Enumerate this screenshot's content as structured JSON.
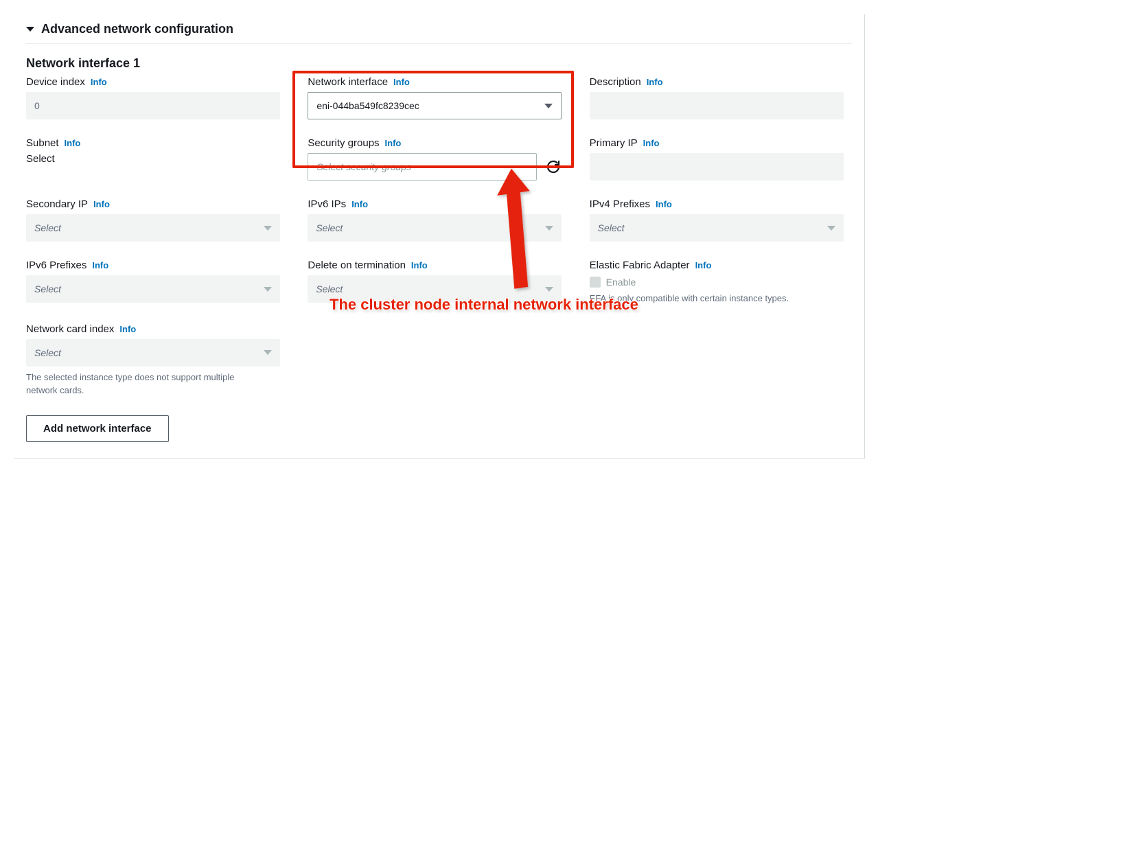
{
  "header": {
    "title": "Advanced network configuration"
  },
  "section_title": "Network interface 1",
  "info_label": "Info",
  "fields": {
    "device_index": {
      "label": "Device index",
      "value": "0"
    },
    "network_interface": {
      "label": "Network interface",
      "value": "eni-044ba549fc8239cec"
    },
    "description": {
      "label": "Description"
    },
    "subnet": {
      "label": "Subnet",
      "value": "Select"
    },
    "security_groups": {
      "label": "Security groups",
      "placeholder": "Select security groups"
    },
    "primary_ip": {
      "label": "Primary IP"
    },
    "secondary_ip": {
      "label": "Secondary IP",
      "placeholder": "Select"
    },
    "ipv6_ips": {
      "label": "IPv6 IPs",
      "placeholder": "Select"
    },
    "ipv4_prefixes": {
      "label": "IPv4 Prefixes",
      "placeholder": "Select"
    },
    "ipv6_prefixes": {
      "label": "IPv6 Prefixes",
      "placeholder": "Select"
    },
    "delete_on_term": {
      "label": "Delete on termination",
      "placeholder": "Select"
    },
    "efa": {
      "label": "Elastic Fabric Adapter",
      "checkbox_label": "Enable",
      "help": "EFA is only compatible with certain instance types."
    },
    "net_card_index": {
      "label": "Network card index",
      "placeholder": "Select",
      "help": "The selected instance type does not support multiple network cards."
    }
  },
  "add_button": "Add network interface",
  "annotation": "The cluster node internal network interface"
}
